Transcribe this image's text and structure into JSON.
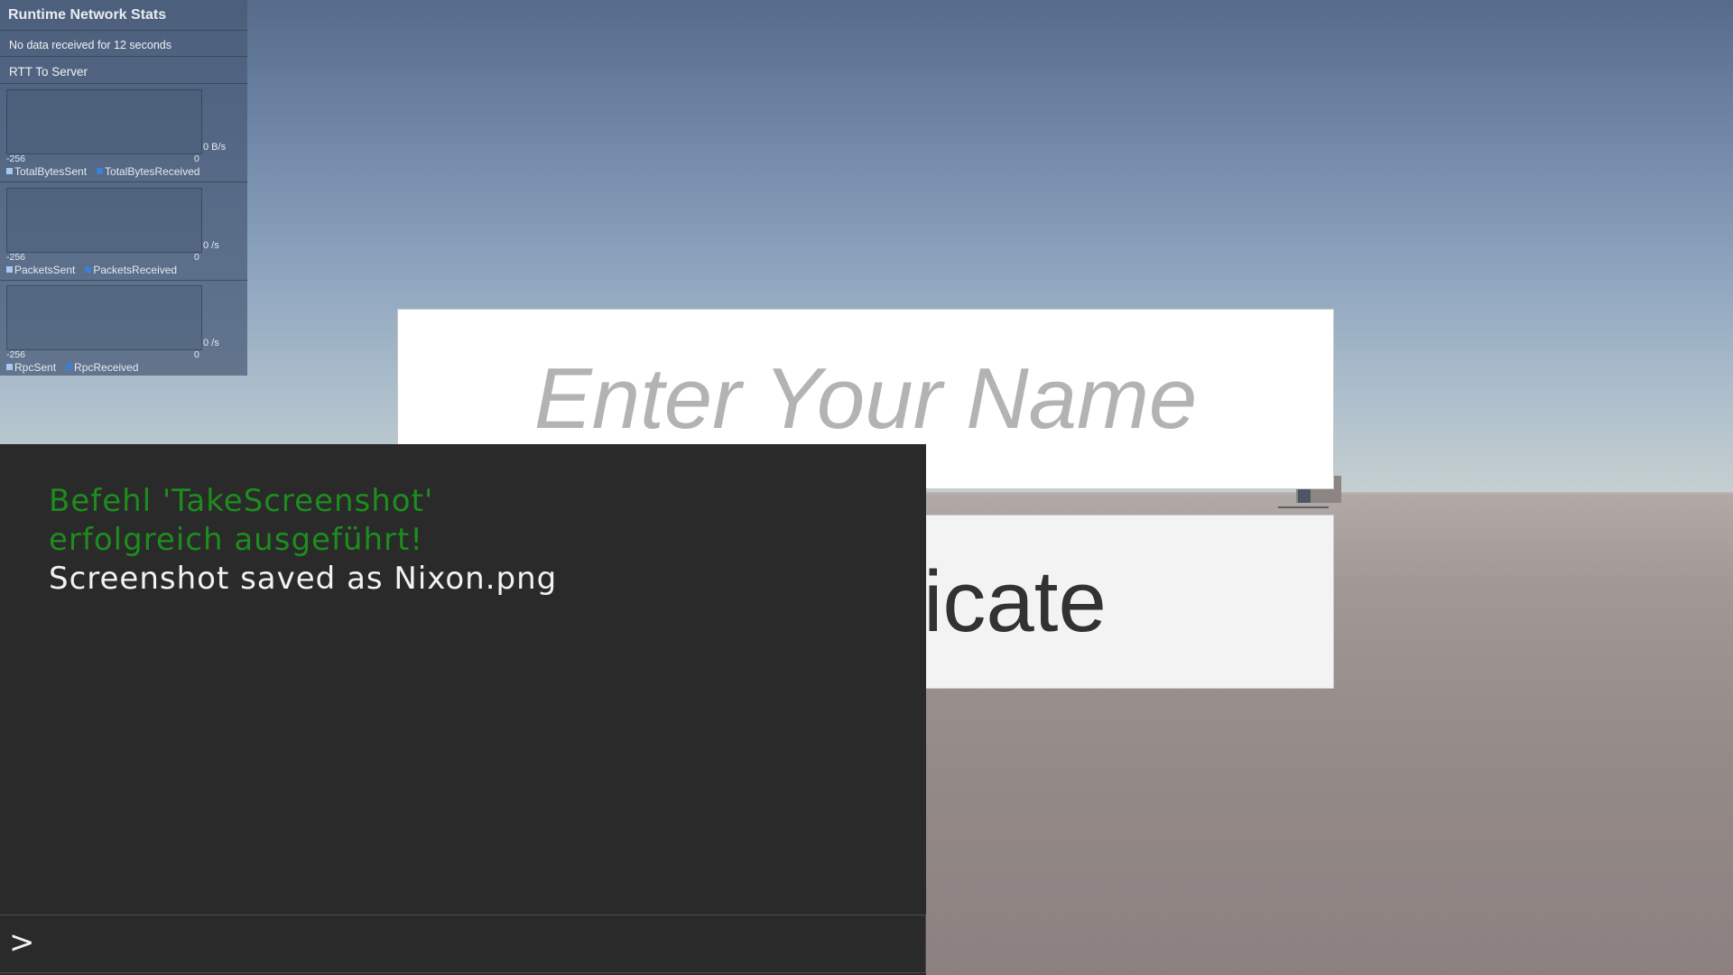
{
  "stats_panel": {
    "title": "Runtime Network Stats",
    "status": "No data received for 12 seconds",
    "rtt_label": "RTT To Server",
    "graphs": [
      {
        "unit": "0 B/s",
        "min_label": "-256",
        "max_label": "0",
        "legend": [
          {
            "label": "TotalBytesSent",
            "color": "#a8c8f0"
          },
          {
            "label": "TotalBytesReceived",
            "color": "#3f7fd0"
          }
        ]
      },
      {
        "unit": "0 /s",
        "min_label": "-256",
        "max_label": "0",
        "legend": [
          {
            "label": "PacketsSent",
            "color": "#a8c8f0"
          },
          {
            "label": "PacketsReceived",
            "color": "#3f7fd0"
          }
        ]
      },
      {
        "unit": "0 /s",
        "min_label": "-256",
        "max_label": "0",
        "legend": [
          {
            "label": "RpcSent",
            "color": "#a8c8f0"
          },
          {
            "label": "RpcReceived",
            "color": "#3f7fd0"
          }
        ]
      }
    ]
  },
  "name_field": {
    "placeholder": "Enter Your Name",
    "value": ""
  },
  "auth_button": {
    "label": "Authenticate"
  },
  "console": {
    "lines": [
      {
        "text": "Befehl 'TakeScreenshot'",
        "kind": "success"
      },
      {
        "text": "erfolgreich ausgeführt!",
        "kind": "success"
      },
      {
        "text": "Screenshot saved as Nixon.png",
        "kind": "info"
      }
    ],
    "prompt": ">",
    "input_value": ""
  },
  "colors": {
    "success_text": "#1e8c1e",
    "console_bg": "#2a2a2a",
    "stats_panel_bg": "#485a76"
  }
}
